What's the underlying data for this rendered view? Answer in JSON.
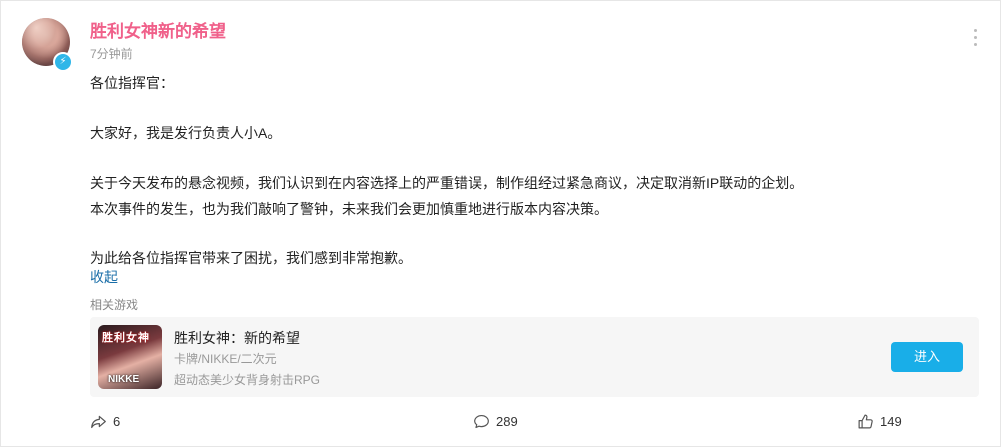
{
  "post": {
    "author": "胜利女神新的希望",
    "time": "7分钟前",
    "lines": [
      "各位指挥官：",
      "大家好，我是发行负责人小A。",
      "关于今天发布的悬念视频，我们认识到在内容选择上的严重错误，制作组经过紧急商议，决定取消新IP联动的企划。",
      "本次事件的发生，也为我们敲响了警钟，未来我们会更加慎重地进行版本内容决策。",
      "为此给各位指挥官带来了困扰，我们感到非常抱歉。"
    ],
    "collapse_label": "收起"
  },
  "related": {
    "label": "相关游戏",
    "game": {
      "name": "胜利女神：新的希望",
      "tags": "卡牌/NIKKE/二次元",
      "desc": "超动态美少女背身射击RPG",
      "enter_label": "进入",
      "cover_text_top": "胜利女神",
      "cover_text_bottom": "NIKKE"
    }
  },
  "actions": {
    "share_count": "6",
    "comment_count": "289",
    "like_count": "149"
  },
  "colors": {
    "author": "#f0608a",
    "accent": "#19aee8",
    "link": "#1a6ea8"
  }
}
